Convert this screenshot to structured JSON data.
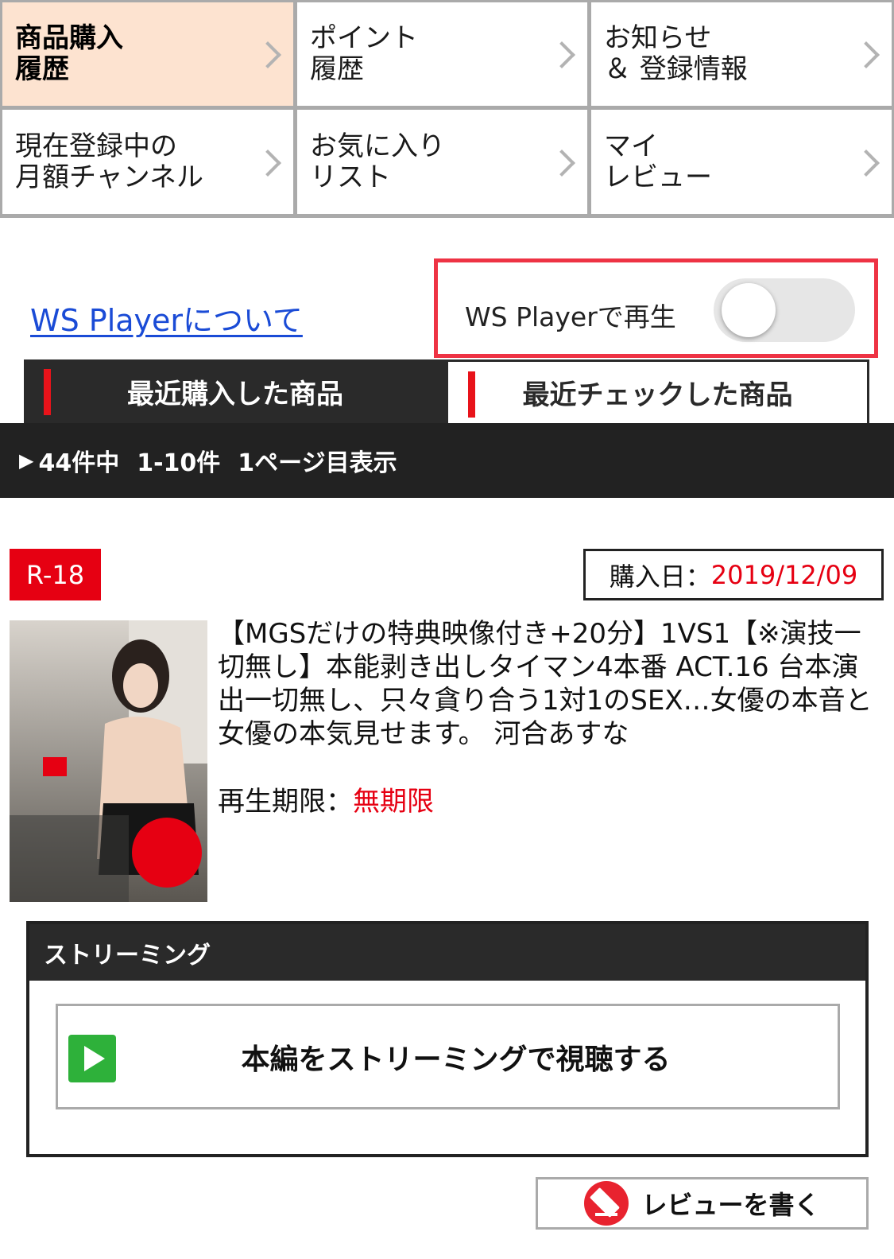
{
  "menu": [
    {
      "label": "商品購入\n履歴",
      "active": true
    },
    {
      "label": "ポイント\n履歴",
      "active": false
    },
    {
      "label": "お知らせ\n＆ 登録情報",
      "active": false
    },
    {
      "label": "現在登録中の\n月額チャンネル",
      "active": false
    },
    {
      "label": "お気に入り\nリスト",
      "active": false
    },
    {
      "label": "マイ\nレビュー",
      "active": false
    }
  ],
  "ws_player": {
    "link_text": "WS Playerについて",
    "toggle_label": "WS Playerで再生",
    "toggle_on": false
  },
  "tabs": {
    "recent_purchased": "最近購入した商品",
    "recent_checked": "最近チェックした商品"
  },
  "result": {
    "total": "44件中",
    "range": "1-10件",
    "page": "1ページ目表示"
  },
  "item": {
    "rating": "R-18",
    "purchase_date_label": "購入日：",
    "purchase_date": "2019/12/09",
    "title": "【MGSだけの特典映像付き+20分】1VS1【※演技一切無し】本能剥き出しタイマン4本番 ACT.16 台本演出一切無し、只々貪り合う1対1のSEX…女優の本音と女優の本気見せます。 河合あすな",
    "expire_label": "再生期限：",
    "expire_value": "無期限"
  },
  "streaming": {
    "header": "ストリーミング",
    "button_label": "本編をストリーミングで視聴する"
  },
  "review": {
    "button_label": "レビューを書く"
  },
  "colors": {
    "accent_red": "#e60012",
    "active_menu_bg": "#fde3d0",
    "dark_bar": "#222222",
    "link_blue": "#1a4bd6",
    "play_green": "#2eb13a"
  }
}
